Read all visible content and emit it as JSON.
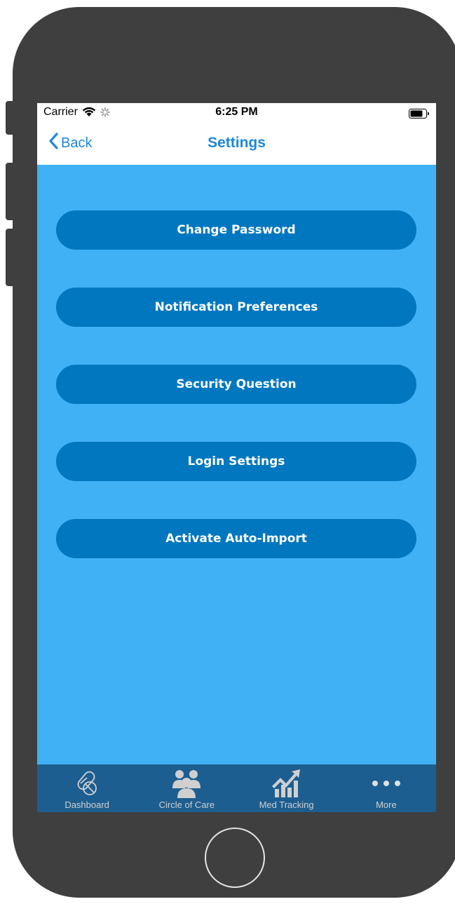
{
  "status_bar": {
    "carrier": "Carrier",
    "time": "6:25 PM"
  },
  "nav": {
    "back_label": "Back",
    "title": "Settings"
  },
  "menu": {
    "items": [
      {
        "label": "Change Password"
      },
      {
        "label": "Notification Preferences"
      },
      {
        "label": "Security Question"
      },
      {
        "label": "Login Settings"
      },
      {
        "label": "Activate Auto-Import"
      }
    ]
  },
  "tab_bar": {
    "items": [
      {
        "label": "Dashboard",
        "icon": "pills-icon"
      },
      {
        "label": "Circle of Care",
        "icon": "people-icon"
      },
      {
        "label": "Med Tracking",
        "icon": "chart-trend-icon"
      },
      {
        "label": "More",
        "icon": "more-dots-icon"
      }
    ]
  },
  "colors": {
    "screen_background": "#41b1f5",
    "button_background": "#0077bf",
    "accent": "#1e88d9",
    "tab_bar_background": "#1d5e90",
    "device_body": "#3f3f3f"
  }
}
